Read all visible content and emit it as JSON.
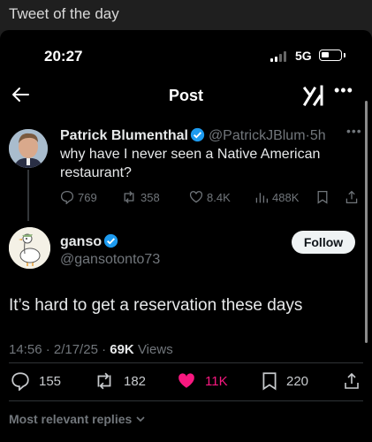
{
  "caption": "Tweet of the day",
  "status_bar": {
    "time": "20:27",
    "network": "5G"
  },
  "nav": {
    "title": "Post"
  },
  "quoted_tweet": {
    "name": "Patrick Blumenthal",
    "handle": "@PatrickJBlum",
    "sep": "·",
    "age": "5h",
    "text": "why have I never seen a Native American restaurant?",
    "replies": "769",
    "reposts": "358",
    "likes": "8.4K",
    "views": "488K"
  },
  "main_tweet": {
    "name": "ganso",
    "handle": "@gansotonto73",
    "follow_label": "Follow",
    "text": "It’s hard to get a reservation these days",
    "timestamp": "14:56 · 2/17/25 · ",
    "views_count": "69K",
    "views_label": "Views",
    "replies": "155",
    "reposts": "182",
    "likes": "11K",
    "bookmarks": "220"
  },
  "replies_filter": "Most relevant replies",
  "colors": {
    "like_pink": "#f91880",
    "verified_blue": "#1d9bf0",
    "background": "#000000"
  }
}
